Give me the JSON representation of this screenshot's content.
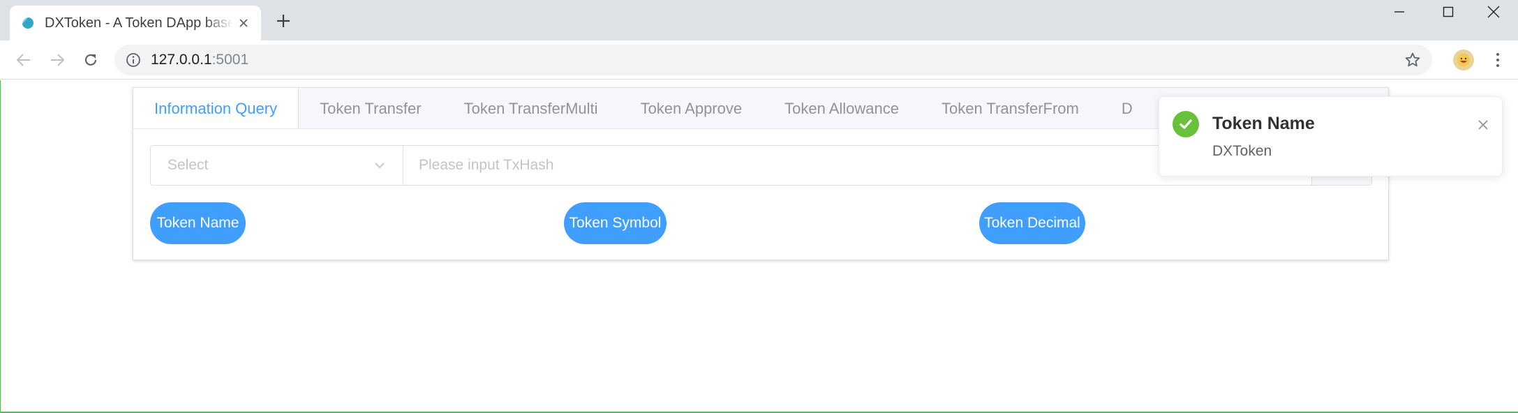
{
  "browser": {
    "tab_title": "DXToken - A Token DApp based",
    "url_host": "127.0.0.1",
    "url_port": ":5001"
  },
  "app": {
    "tabs": [
      {
        "label": "Information Query",
        "active": true
      },
      {
        "label": "Token Transfer",
        "active": false
      },
      {
        "label": "Token TransferMulti",
        "active": false
      },
      {
        "label": "Token Approve",
        "active": false
      },
      {
        "label": "Token Allowance",
        "active": false
      },
      {
        "label": "Token TransferFrom",
        "active": false
      },
      {
        "label": "D",
        "active": false
      }
    ],
    "query": {
      "select_placeholder": "Select",
      "input_placeholder": "Please input TxHash"
    },
    "buttons": {
      "token_name": "Token Name",
      "token_symbol": "Token Symbol",
      "token_decimal": "Token Decimal"
    },
    "accent_color": "#409eff"
  },
  "notification": {
    "title": "Token Name",
    "message": "DXToken",
    "type": "success",
    "icon": "check-circle-icon",
    "color": "#67c23a"
  }
}
